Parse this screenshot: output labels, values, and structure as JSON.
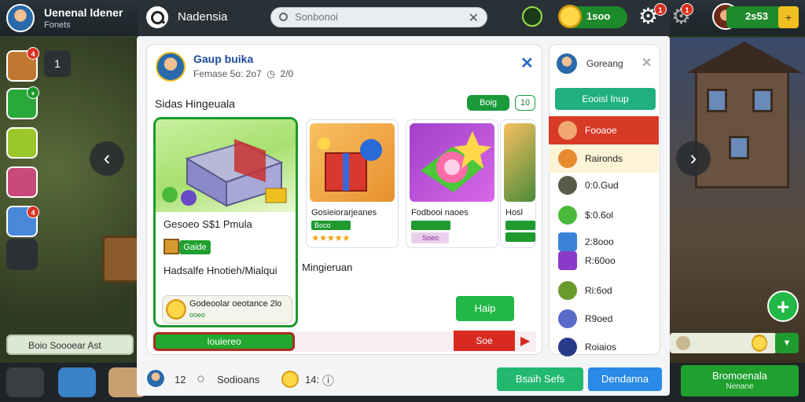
{
  "player": {
    "name": "Uenenal ldener",
    "status": "Fonets"
  },
  "header": {
    "title": "Nadensia",
    "search_placeholder": "Sonbonoi"
  },
  "hud": {
    "coins": "1soo",
    "gear_badge": "1",
    "settings_badge": "1",
    "gold": "2s53",
    "gold_add": "+"
  },
  "left_tools": {
    "badge1": "4",
    "badge2": "+",
    "badge3": "4",
    "lock_label": "1"
  },
  "left_pill": {
    "label": "Boio Soooear Ast"
  },
  "dialog": {
    "title": "Gaup buika",
    "subtitle": "Femase 5o: 2o7",
    "subtitle_count": "2/0",
    "section_title": "Sidas Hingeuala",
    "chip_primary": "Boig",
    "chip_secondary": "10",
    "featured": {
      "title": "Gesoeo S$1 Pmula",
      "chip": "Gaide",
      "description": "Hadsalfe Hnotieh/Mialqui",
      "coin_title": "Godeoolar oeotance 2lo",
      "coin_sub": "ooeo"
    },
    "mid_description": "Mingieruan",
    "items": [
      {
        "title": "Gosieiorarjeanes",
        "chip": "Boco"
      },
      {
        "title": "Fodbooi naoes",
        "chip": "Soeo"
      },
      {
        "title": "Hosl"
      }
    ],
    "help_button": "Haip",
    "buy_button": "Iouiereo",
    "red_button": "Soe",
    "red_icon": "▶"
  },
  "side": {
    "title": "Goreang",
    "button": "Eooisl Inup",
    "rows": [
      {
        "label": "Fooaoe"
      },
      {
        "label": "Raironds"
      },
      {
        "label": "0:0.Gud"
      },
      {
        "label": "$:0.6ol"
      },
      {
        "label": "2:8ooo"
      },
      {
        "label": "R:60oo"
      },
      {
        "label": "Ri:6od"
      },
      {
        "label": "R9oed"
      },
      {
        "label": "Roiaios"
      }
    ]
  },
  "footer": {
    "count": "12",
    "search_label": "Sodioans",
    "coin_count": "14:",
    "coin_info": "ⓘ",
    "btn_green": "Bsaih Sefs",
    "btn_blue": "Dendanna",
    "big_green_l1": "Bromoenala",
    "big_green_l2": "Nenane"
  },
  "colors": {
    "accent_green": "#22b848",
    "accent_blue": "#2a8ae8",
    "danger": "#d82a20"
  }
}
